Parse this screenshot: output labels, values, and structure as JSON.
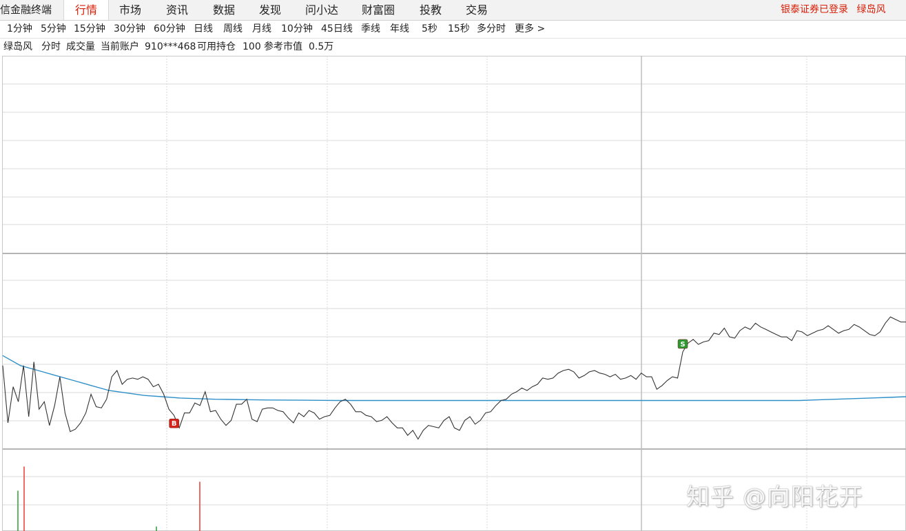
{
  "app": {
    "title": "信金融终端"
  },
  "menu": [
    {
      "label": "行情",
      "active": true
    },
    {
      "label": "市场"
    },
    {
      "label": "资讯"
    },
    {
      "label": "数据"
    },
    {
      "label": "发现"
    },
    {
      "label": "问小达"
    },
    {
      "label": "财富圈"
    },
    {
      "label": "投教"
    },
    {
      "label": "交易"
    }
  ],
  "login": {
    "broker_status": "银泰证券已登录",
    "user": "绿岛风"
  },
  "periods": [
    "1分钟",
    "5分钟",
    "15分钟",
    "30分钟",
    "60分钟",
    "日线",
    "周线",
    "月线",
    "10分钟",
    "45日线",
    "季线",
    "年线",
    "5秒",
    "15秒",
    "多分时",
    "更多 >"
  ],
  "info": {
    "stock": "绿岛风",
    "mode": "分时",
    "volume_label": "成交量",
    "account_label": "当前账户",
    "account_value": "910***468",
    "holding_label": "可用持仓",
    "holding_value": "100",
    "market_value_label": "参考市值",
    "market_value": "0.5万"
  },
  "colors": {
    "price_line": "#333333",
    "avg_line": "#2e8fc8",
    "buy_marker": "#d2241a",
    "sell_marker": "#2e9a34",
    "volume_up": "#e23a2e",
    "volume_down": "#2e9a34",
    "grid": "#d9d9d9"
  },
  "markers": [
    {
      "type": "buy",
      "label": "B",
      "index": 33
    },
    {
      "type": "sell",
      "label": "S",
      "index": 131
    }
  ],
  "chart_data": {
    "type": "line",
    "series": [
      {
        "key": "price",
        "values": [
          0.62,
          0.16,
          0.45,
          0.33,
          0.62,
          0.21,
          0.65,
          0.27,
          0.33,
          0.14,
          0.3,
          0.53,
          0.24,
          0.09,
          0.11,
          0.16,
          0.24,
          0.39,
          0.29,
          0.28,
          0.35,
          0.53,
          0.58,
          0.47,
          0.51,
          0.52,
          0.51,
          0.53,
          0.51,
          0.45,
          0.47,
          0.39,
          0.27,
          0.22,
          0.12,
          0.24,
          0.24,
          0.32,
          0.3,
          0.41,
          0.25,
          0.26,
          0.19,
          0.14,
          0.18,
          0.31,
          0.31,
          0.35,
          0.19,
          0.17,
          0.27,
          0.28,
          0.28,
          0.26,
          0.25,
          0.2,
          0.16,
          0.24,
          0.21,
          0.26,
          0.24,
          0.19,
          0.21,
          0.22,
          0.28,
          0.33,
          0.35,
          0.31,
          0.25,
          0.25,
          0.22,
          0.21,
          0.17,
          0.18,
          0.21,
          0.16,
          0.12,
          0.12,
          0.06,
          0.1,
          0.03,
          0.1,
          0.14,
          0.13,
          0.12,
          0.18,
          0.21,
          0.12,
          0.1,
          0.18,
          0.21,
          0.15,
          0.18,
          0.24,
          0.25,
          0.3,
          0.34,
          0.35,
          0.39,
          0.41,
          0.44,
          0.42,
          0.45,
          0.47,
          0.52,
          0.51,
          0.52,
          0.56,
          0.58,
          0.59,
          0.57,
          0.52,
          0.54,
          0.57,
          0.58,
          0.56,
          0.55,
          0.53,
          0.55,
          0.51,
          0.52,
          0.54,
          0.51,
          0.56,
          0.53,
          0.53,
          0.43,
          0.46,
          0.5,
          0.53,
          0.52,
          0.73,
          0.8,
          0.83,
          0.79,
          0.81,
          0.82,
          0.88,
          0.87,
          0.92,
          0.85,
          0.84,
          0.9,
          0.93,
          0.91,
          0.96,
          0.93,
          0.91,
          0.89,
          0.87,
          0.85,
          0.85,
          0.82,
          0.9,
          0.89,
          0.86,
          0.88,
          0.9,
          0.91,
          0.94,
          0.91,
          0.88,
          0.9,
          0.91,
          0.95,
          0.93,
          0.9,
          0.87,
          0.86,
          0.89,
          0.96,
          1.01,
          0.99,
          0.97,
          0.97
        ]
      },
      {
        "key": "average",
        "values": [
          0.7,
          0.62,
          0.58,
          0.54,
          0.5,
          0.46,
          0.42,
          0.4,
          0.38,
          0.37,
          0.36,
          0.355,
          0.35,
          0.348,
          0.346,
          0.344,
          0.343,
          0.342,
          0.341,
          0.34,
          0.34,
          0.34,
          0.34,
          0.34,
          0.34,
          0.34,
          0.34,
          0.34,
          0.34,
          0.34,
          0.34,
          0.34,
          0.34,
          0.34,
          0.34,
          0.34,
          0.34,
          0.34,
          0.34,
          0.34,
          0.34,
          0.34,
          0.34,
          0.34,
          0.34,
          0.34,
          0.345,
          0.35,
          0.355,
          0.36,
          0.365,
          0.37
        ]
      }
    ],
    "volume": [
      0.45,
      0.72,
      0,
      0,
      0,
      0,
      0,
      0,
      0.05,
      0,
      0,
      0,
      0.55,
      0,
      0,
      0,
      0,
      0,
      0,
      0
    ]
  }
}
